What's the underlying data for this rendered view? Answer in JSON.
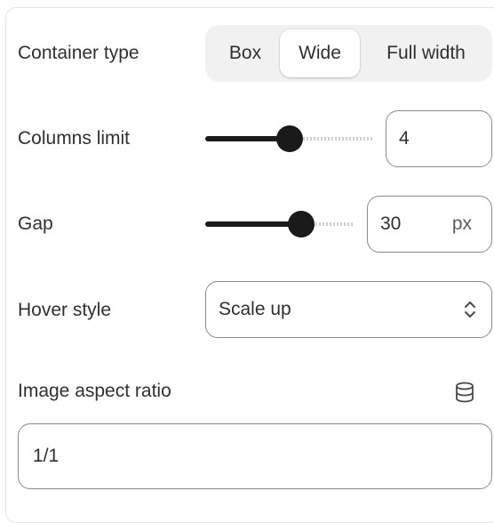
{
  "container_type": {
    "label": "Container type",
    "options": [
      "Box",
      "Wide",
      "Full width"
    ],
    "selected": "Wide"
  },
  "columns_limit": {
    "label": "Columns limit",
    "value": "4",
    "slider_fraction": 0.52
  },
  "gap": {
    "label": "Gap",
    "value": "30",
    "unit": "px",
    "slider_fraction": 0.71
  },
  "hover_style": {
    "label": "Hover style",
    "value": "Scale up"
  },
  "image_aspect_ratio": {
    "label": "Image aspect ratio",
    "value": "1/1",
    "icon": "database-icon"
  }
}
